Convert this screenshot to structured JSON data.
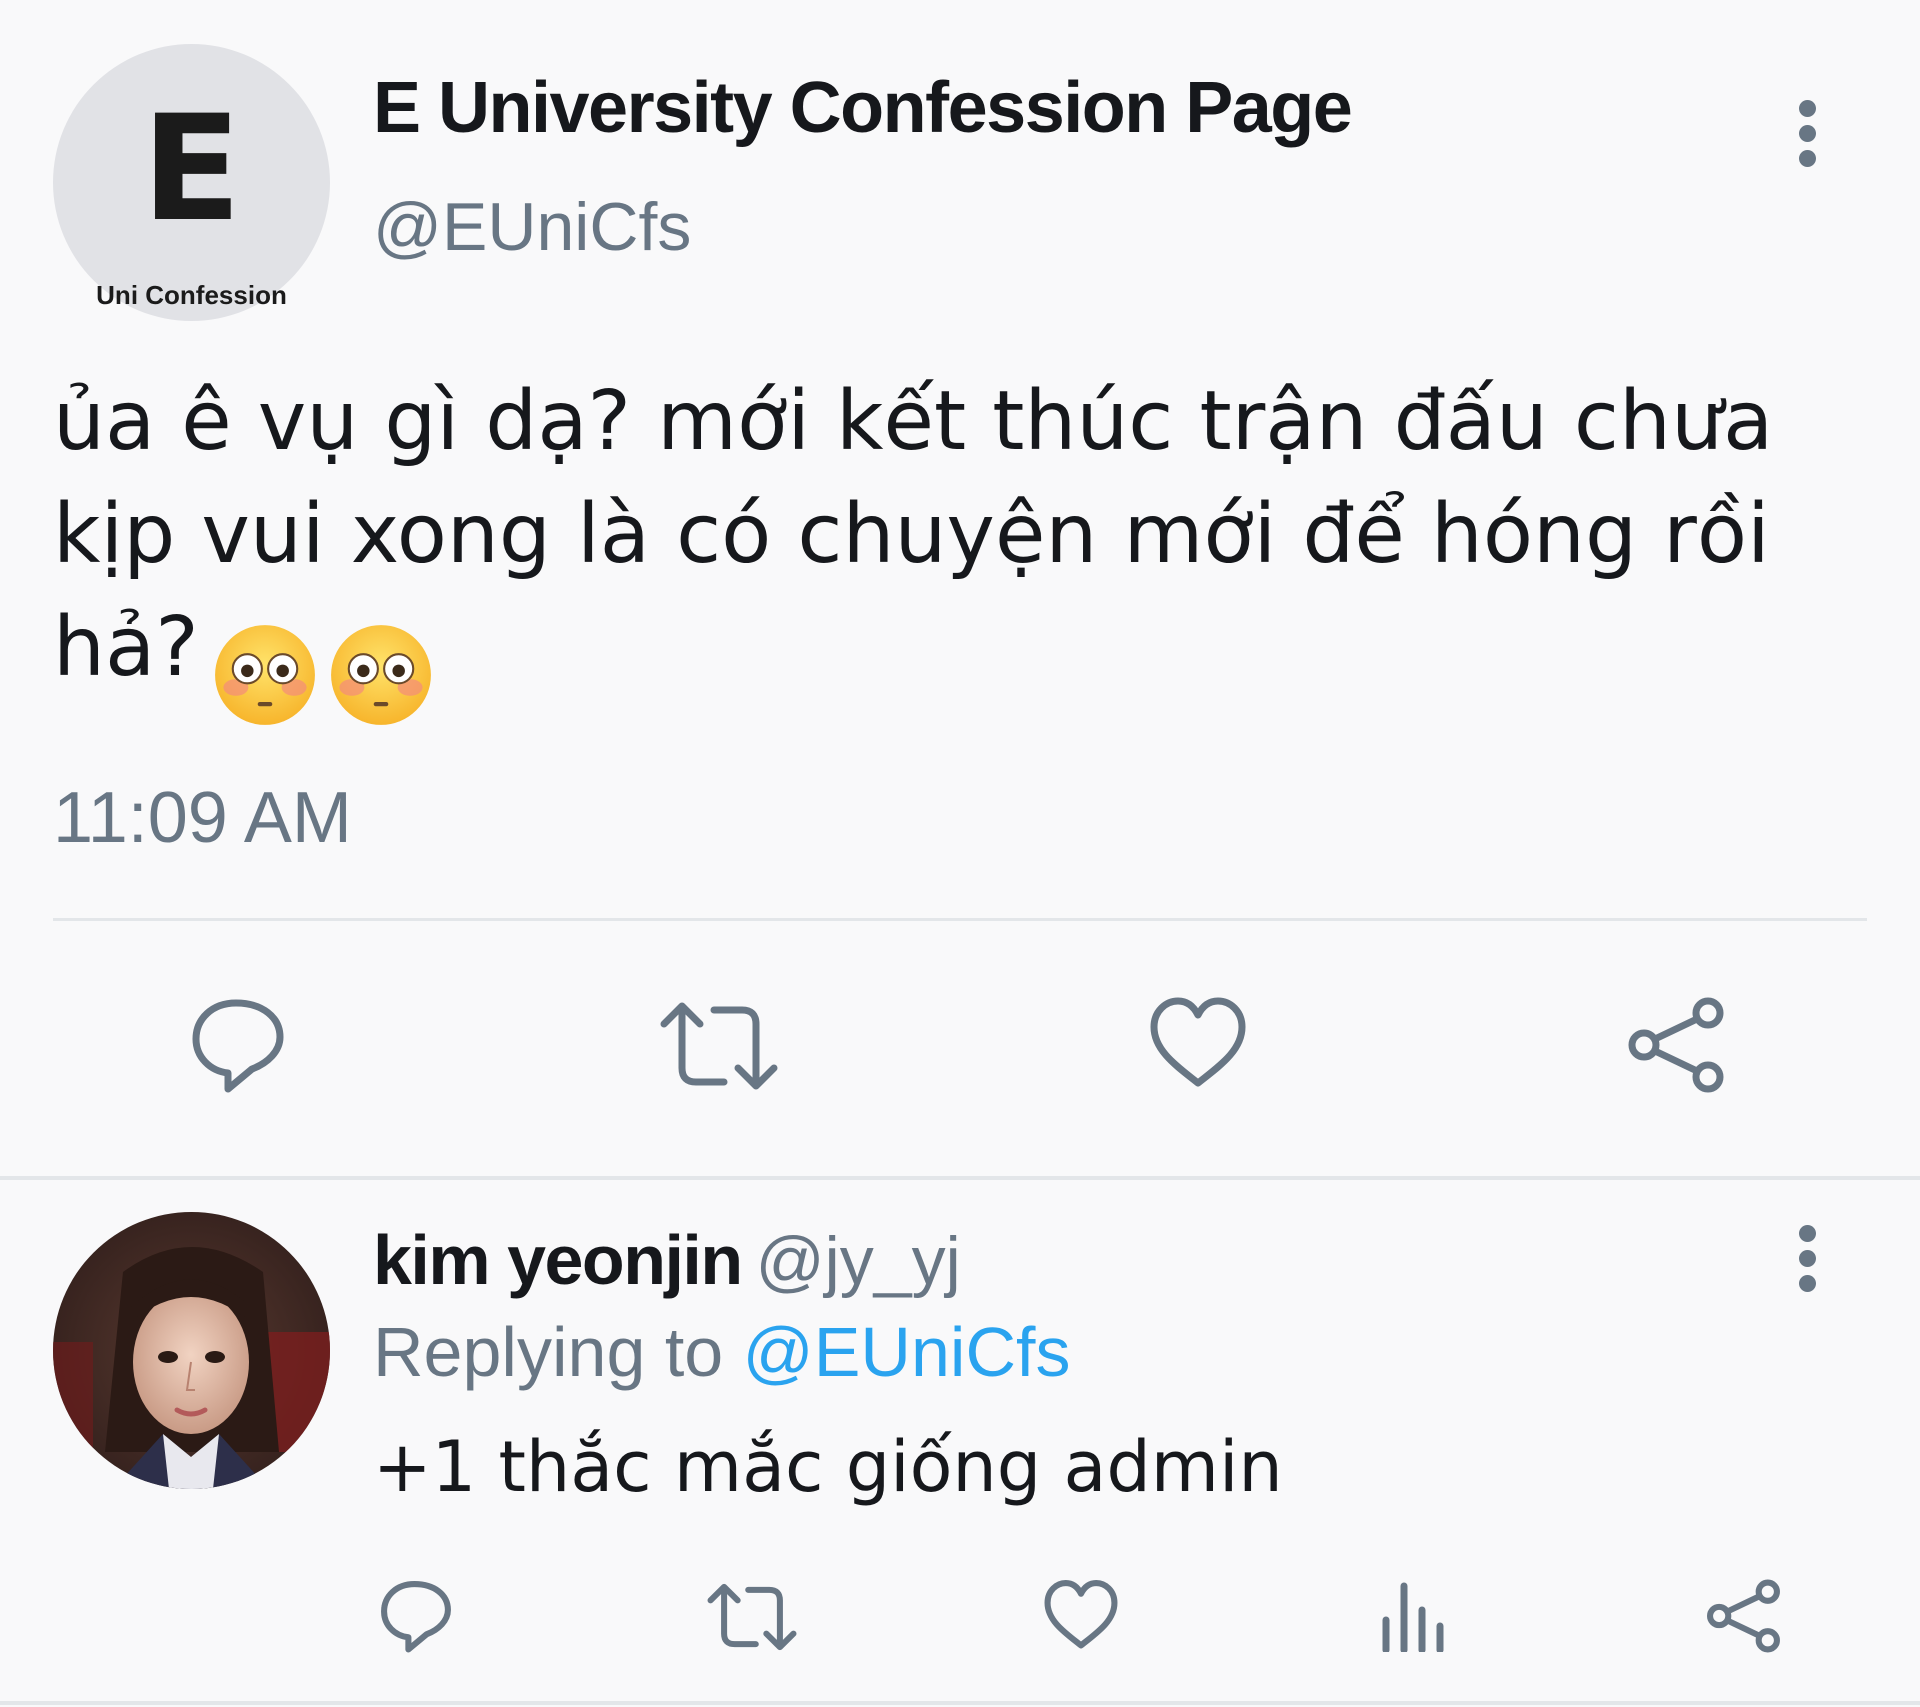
{
  "colors": {
    "background": "#f9f9fa",
    "text_primary": "#16181c",
    "text_secondary": "#687684",
    "mention": "#2aa3ef",
    "divider": "#e3e6e9",
    "logo_bg": "#e1e2e6"
  },
  "main_tweet": {
    "avatar": {
      "logo_letter": "E",
      "logo_caption": "Uni Confession"
    },
    "display_name": "E University Confession Page",
    "handle": "@EUniCfs",
    "text": "ủa ê vụ gì dạ? mới kết thúc trận đấu chưa kịp vui xong là có chuyện mới để hóng rồi hả?",
    "emojis": [
      "flushed-face-emoji",
      "flushed-face-emoji"
    ],
    "timestamp": "11:09 AM",
    "actions": [
      "reply-icon",
      "retweet-icon",
      "like-icon",
      "share-icon"
    ]
  },
  "reply_tweet": {
    "display_name": "kim yeonjin",
    "handle": "@jy_yj",
    "replying_prefix": "Replying to",
    "replying_to": "@EUniCfs",
    "text": "+1 thắc mắc giống admin",
    "actions": [
      "reply-icon",
      "retweet-icon",
      "like-icon",
      "stats-icon",
      "share-icon"
    ]
  }
}
